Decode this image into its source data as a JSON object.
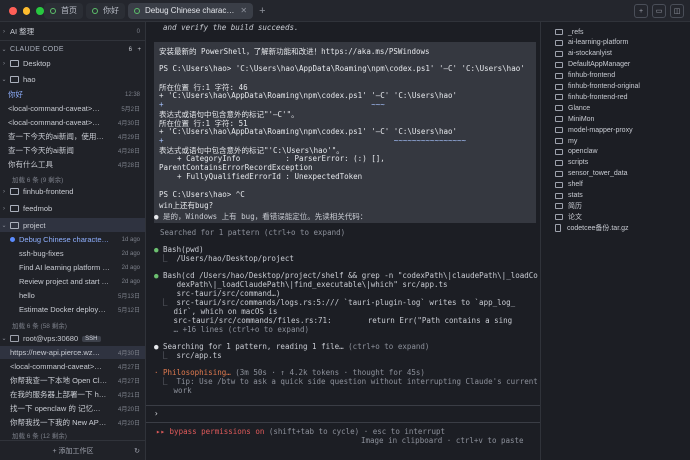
{
  "tabs": [
    {
      "label": "首页"
    },
    {
      "label": "你好"
    },
    {
      "label": "Debug Chinese charac…"
    }
  ],
  "sidebar": {
    "ai_label": "AI 整理",
    "ai_count": "0",
    "claude_code_label": "CLAUDE CODE",
    "claude_code_count": "6",
    "desktop": "Desktop",
    "hao": "hao",
    "hao_items": [
      {
        "label": "你好",
        "date": "12:38"
      },
      {
        "label": "<local-command-caveat>…",
        "date": "5月2日"
      },
      {
        "label": "<local-command-caveat>…",
        "date": "4月30日"
      },
      {
        "label": "查一下今天的ai新闻，使用…",
        "date": "4月29日"
      },
      {
        "label": "查一下今天的ai新闻",
        "date": "4月28日"
      },
      {
        "label": "你有什么工具",
        "date": "4月28日"
      }
    ],
    "hao_more": "加载 6 条 (9 剩余)",
    "finhub": "finhub-frontend",
    "feedmob": "feedmob",
    "project": "project",
    "project_items": [
      {
        "label": "Debug Chinese characte…",
        "date": "1d ago"
      },
      {
        "label": "ssh-bug-fixes",
        "date": "2d ago"
      },
      {
        "label": "Find AI learning platform …",
        "date": "2d ago"
      },
      {
        "label": "Review project and start …",
        "date": "2d ago"
      },
      {
        "label": "hello",
        "date": "5月13日"
      },
      {
        "label": "Estimate Docker deploym…",
        "date": "5月12日"
      }
    ],
    "project_more": "加载 6 条 (58 剩余)",
    "vps": "root@vps:30680",
    "vps_badge": "SSH",
    "vps_items": [
      {
        "label": "https://new-api.pierce.wz…",
        "date": "4月30日"
      },
      {
        "label": "<local-command-caveat>…",
        "date": "4月27日"
      },
      {
        "label": "你帮我查一下本地 Open Cl…",
        "date": "4月27日"
      },
      {
        "label": "在我的服务器上部署一下 h…",
        "date": "4月21日"
      },
      {
        "label": "找一下 openclaw 的 记忆…",
        "date": "4月20日"
      },
      {
        "label": "你帮我找一下我的 New AP…",
        "date": "4月20日"
      }
    ],
    "vps_more": "加载 6 条 (12 剩余)",
    "footer": "+ 添加工作区"
  },
  "terminal": {
    "top_line": "  and verify the build succeeds.",
    "block_lines": [
      "安装最新的 PowerShell，了解新功能和改进！https://aka.ms/PSWindows",
      "",
      "PS C:\\Users\\hao> 'C:\\Users\\hao\\AppData\\Roaming\\npm\\codex.ps1' '–C' 'C:\\Users\\hao'",
      "",
      "所在位置 行:1 字符: 46",
      "+ 'C:\\Users\\hao\\AppData\\Roaming\\npm\\codex.ps1' '–C' 'C:\\Users\\hao'",
      "+                                              ~~~",
      "表达式或语句中包含意外的标记\"'–C'\"。",
      "所在位置 行:1 字符: 51",
      "+ 'C:\\Users\\hao\\AppData\\Roaming\\npm\\codex.ps1' '–C' 'C:\\Users\\hao'",
      "+                                                   ~~~~~~~~~~~~~~~~",
      "表达式或语句中包含意外的标记\"'C:\\Users\\hao'\"。",
      "    + CategoryInfo          : ParserError: (:) [],",
      "ParentContainsErrorRecordException",
      "    + FullyQualifiedErrorId : UnexpectedToken",
      "",
      "PS C:\\Users\\hao> ^C",
      "win上还有bug?"
    ],
    "reply": "是的，Windows 上有 bug，看错误能定位。先读相关代码：",
    "search1": "Searched for 1 pattern (ctrl+o to expand)",
    "bash1_cmd": "Bash(pwd)",
    "bash1_out": "/Users/hao/Desktop/project",
    "bash2_lines": [
      "Bash(cd /Users/hao/Desktop/project/shelf && grep -n \"codexPath\\|claudePath\\|_loadCo",
      "     dexPath\\|_loadClaudePath\\|find_executable\\|which\" src/app.ts",
      "     src-tauri/src/command…)"
    ],
    "bash2_out": [
      "src-tauri/src/commands/logs.rs:5:/// `tauri-plugin-log` writes to `app_log_",
      "dir`, which on macOS is",
      "src-tauri/src/commands/files.rs:71:        return Err(\"Path contains a sing",
      "… +16 lines (ctrl+o to expand)"
    ],
    "search2": "Searching for 1 pattern, reading 1 file…",
    "search2_hint": "(ctrl+o to expand)",
    "search2_file": "src/app.ts",
    "phil": "Philosophising…",
    "phil_stats": "(3m 50s · ↑ 4.2k tokens · thought for 45s)",
    "tip_lines": [
      "Tip: Use /btw to ask a quick side question without interrupting Claude's current",
      "work"
    ],
    "prompt_symbol": "›",
    "bypass_prefix": "▸▸ bypass permissions on",
    "bypass_rest": "(shift+tab to cycle) · esc to interrupt",
    "image_hint": "Image in clipboard · ctrl+v to paste"
  },
  "files": [
    {
      "name": "_refs",
      "type": "folder"
    },
    {
      "name": "ai-learning-platform",
      "type": "folder"
    },
    {
      "name": "ai-stockanlyist",
      "type": "folder"
    },
    {
      "name": "DefaultAppManager",
      "type": "folder"
    },
    {
      "name": "finhub-frontend",
      "type": "folder"
    },
    {
      "name": "finhub-frontend-original",
      "type": "folder"
    },
    {
      "name": "finhub-frontend-red",
      "type": "folder"
    },
    {
      "name": "Glance",
      "type": "folder"
    },
    {
      "name": "MiniMon",
      "type": "folder"
    },
    {
      "name": "model-mapper-proxy",
      "type": "folder"
    },
    {
      "name": "my",
      "type": "folder"
    },
    {
      "name": "openclaw",
      "type": "folder"
    },
    {
      "name": "scripts",
      "type": "folder"
    },
    {
      "name": "sensor_tower_data",
      "type": "folder"
    },
    {
      "name": "shelf",
      "type": "folder"
    },
    {
      "name": "stats",
      "type": "folder"
    },
    {
      "name": "简历",
      "type": "folder"
    },
    {
      "name": "论文",
      "type": "folder"
    },
    {
      "name": "codetcee备份.tar.gz",
      "type": "file"
    }
  ],
  "colors": {
    "accent": "#5b8cff",
    "warn": "#e07a4f",
    "danger": "#e05a5a",
    "ok": "#6cc070"
  }
}
